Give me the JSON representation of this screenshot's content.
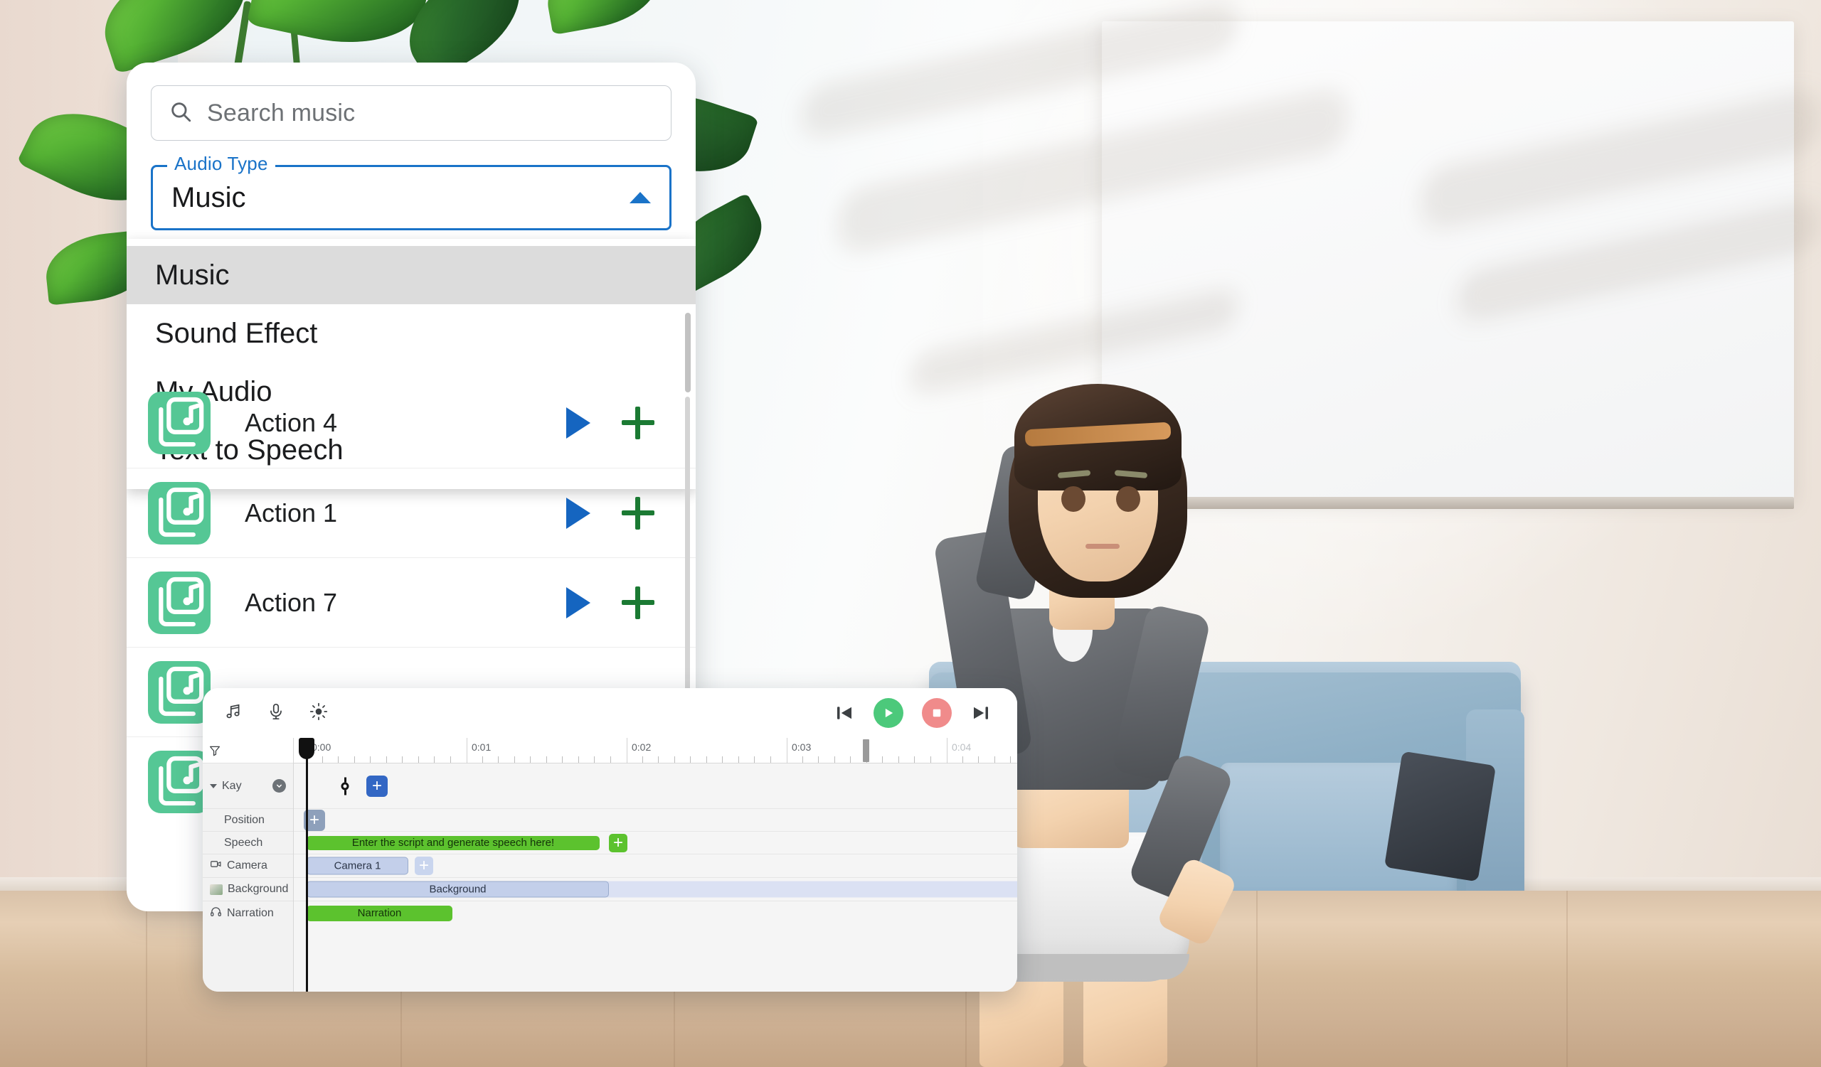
{
  "music_panel": {
    "search": {
      "placeholder": "Search music",
      "icon": "search-icon"
    },
    "audio_type_select": {
      "label": "Audio Type",
      "value": "Music",
      "expanded": true,
      "caret_icon": "caret-up-icon",
      "accent_color": "#1a73c8",
      "options": [
        {
          "label": "Music",
          "selected": true
        },
        {
          "label": "Sound Effect",
          "selected": false
        },
        {
          "label": "My Audio",
          "selected": false
        },
        {
          "label": "Text to Speech",
          "selected": false
        }
      ]
    },
    "items": [
      {
        "name": "Action 4",
        "thumb_icon": "music-file-icon",
        "play_icon": "play-icon",
        "add_icon": "plus-icon"
      },
      {
        "name": "Action 1",
        "thumb_icon": "music-file-icon",
        "play_icon": "play-icon",
        "add_icon": "plus-icon"
      },
      {
        "name": "Action 7",
        "thumb_icon": "music-file-icon",
        "play_icon": "play-icon",
        "add_icon": "plus-icon"
      },
      {
        "name": "",
        "thumb_icon": "music-file-icon",
        "play_icon": "play-icon",
        "add_icon": "plus-icon"
      },
      {
        "name": "",
        "thumb_icon": "music-file-icon",
        "play_icon": "play-icon",
        "add_icon": "plus-icon"
      }
    ],
    "thumb_color": "#55c795",
    "play_color": "#1565c0",
    "add_color": "#1b7a33"
  },
  "timeline_panel": {
    "toolbar_icons": [
      {
        "name": "music-note-icon",
        "title": "Music"
      },
      {
        "name": "microphone-icon",
        "title": "Voice"
      },
      {
        "name": "brightness-icon",
        "title": "Lighting"
      }
    ],
    "transport": [
      {
        "name": "skip-to-start-button",
        "icon": "skip-back-icon"
      },
      {
        "name": "play-button",
        "icon": "play-icon",
        "color": "#4cc97b"
      },
      {
        "name": "stop-button",
        "icon": "stop-icon",
        "color": "#f08b8b"
      },
      {
        "name": "skip-to-end-button",
        "icon": "skip-forward-icon"
      }
    ],
    "filter_icon": "filter-icon",
    "ruler": {
      "labels": [
        {
          "text": "0:00",
          "dim": false
        },
        {
          "text": "0:01",
          "dim": false
        },
        {
          "text": "0:02",
          "dim": false
        },
        {
          "text": "0:03",
          "dim": false
        },
        {
          "text": "0:04",
          "dim": true
        }
      ],
      "minor_ticks_per_second": 9,
      "end_marker_time": "0:03.5"
    },
    "playhead_time": "0:00",
    "tracks": [
      {
        "label": "Kay",
        "icon": null,
        "expandable": true,
        "collapse_icon": "chevron-down-icon",
        "clips": [],
        "keyframe": true,
        "add_button": {
          "label": "+",
          "style": "blue"
        }
      },
      {
        "label": "Position",
        "icon": null,
        "indent": true,
        "clips": [],
        "add_button": {
          "label": "+",
          "style": "slate"
        }
      },
      {
        "label": "Speech",
        "icon": null,
        "indent": true,
        "clips": [
          {
            "label": "Enter the script and generate speech here!",
            "style": "green"
          }
        ],
        "add_button": {
          "label": "+",
          "style": "green"
        }
      },
      {
        "label": "Camera",
        "icon": "video-camera-icon",
        "clips": [
          {
            "label": "Camera 1",
            "style": "blue"
          }
        ],
        "add_button": {
          "label": "+",
          "style": "faint"
        }
      },
      {
        "label": "Background",
        "icon": "image-thumbnail-icon",
        "clips": [
          {
            "label": "Background",
            "style": "blue"
          }
        ],
        "add_button": null
      },
      {
        "label": "Narration",
        "icon": "headphones-icon",
        "clips": [
          {
            "label": "Narration",
            "style": "green"
          }
        ],
        "add_button": null
      }
    ]
  }
}
